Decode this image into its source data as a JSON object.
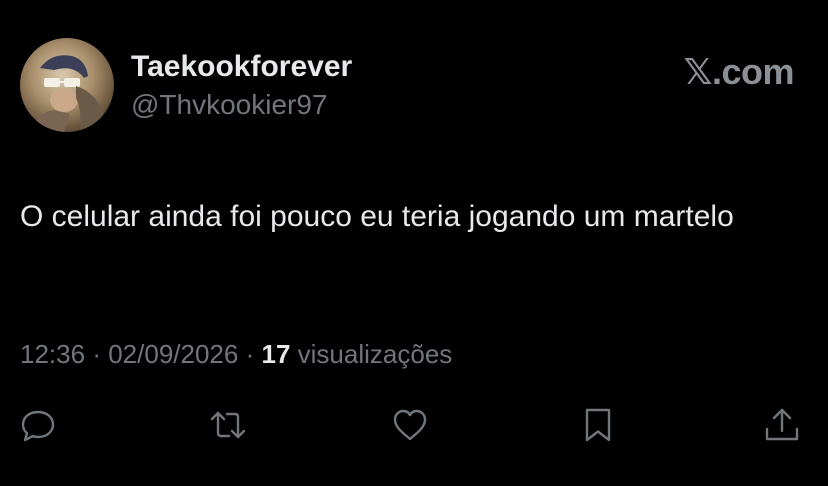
{
  "author": {
    "display_name": "Taekookforever",
    "handle": "@Thvkookier97",
    "avatar_icon": "profile-photo"
  },
  "brand": {
    "label": "𝕏.com"
  },
  "tweet": {
    "text": "O celular ainda foi pouco eu teria jogando um martelo"
  },
  "meta": {
    "time": "12:36",
    "separator_1": "·",
    "date": "02/09/2026",
    "separator_2": "·",
    "views_count": "17",
    "views_label": "visualizações"
  },
  "actions": {
    "reply_icon": "speech-bubble-icon",
    "repost_icon": "repost-arrows-icon",
    "like_icon": "heart-icon",
    "bookmark_icon": "bookmark-icon",
    "share_icon": "share-upload-icon"
  },
  "colors": {
    "background": "#000000",
    "primary_text": "#e7e9ea",
    "secondary_text": "#71767b"
  }
}
